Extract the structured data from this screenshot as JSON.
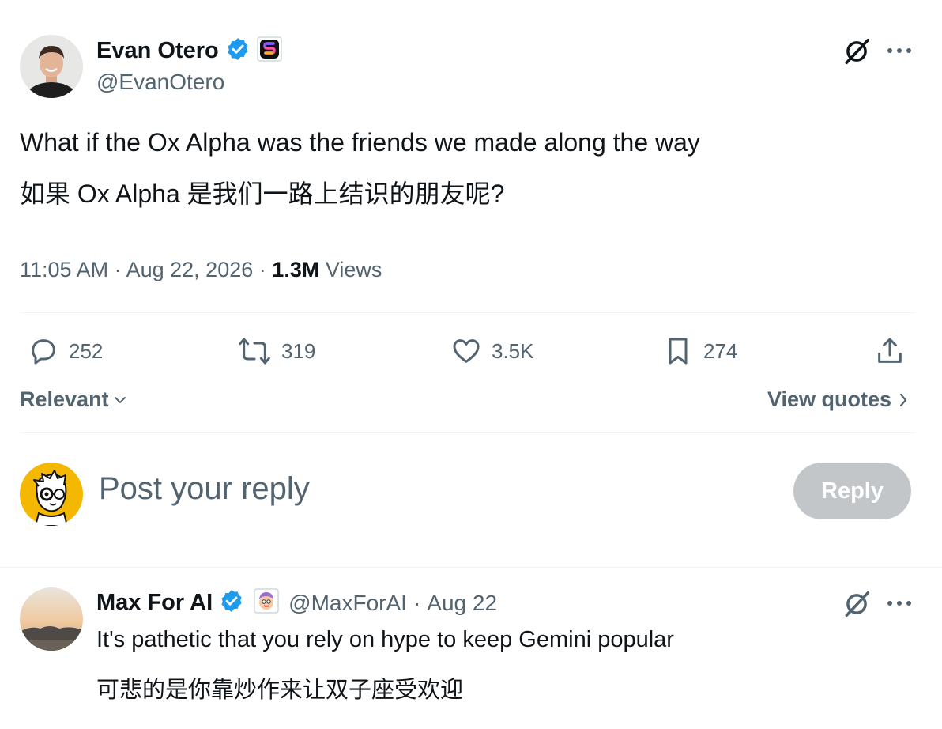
{
  "tweet": {
    "author_name": "Evan Otero",
    "author_handle": "@EvanOtero",
    "text_en": "What if the Ox Alpha was the friends we made along the way",
    "text_zh": "如果 Ox Alpha 是我们一路上结识的朋友呢?",
    "time": "11:05 AM",
    "date": "Aug 22, 2026",
    "views_count": "1.3M",
    "views_label": "Views",
    "separator": "·"
  },
  "actions": {
    "replies": "252",
    "reposts": "319",
    "likes": "3.5K",
    "bookmarks": "274"
  },
  "sort": {
    "label": "Relevant"
  },
  "view_quotes": {
    "label": "View quotes"
  },
  "composer": {
    "placeholder": "Post your reply",
    "button_label": "Reply"
  },
  "reply": {
    "author_name": "Max For AI",
    "author_handle": "@MaxForAI",
    "date": "Aug 22",
    "separator": "·",
    "text_en": "It's pathetic that you rely on hype to keep Gemini popular",
    "text_zh": "可悲的是你靠炒作来让双子座受欢迎"
  },
  "colors": {
    "verified": "#1d9bf0",
    "secondary_text": "#536471",
    "reply_button_disabled": "#c2c6c9"
  },
  "icons": [
    "verified-badge-icon",
    "app-badge-icon",
    "grok-icon",
    "more-icon",
    "reply-icon",
    "repost-icon",
    "like-icon",
    "bookmark-icon",
    "share-icon",
    "chevron-down-icon",
    "chevron-right-icon",
    "emoji-badge-icon"
  ]
}
